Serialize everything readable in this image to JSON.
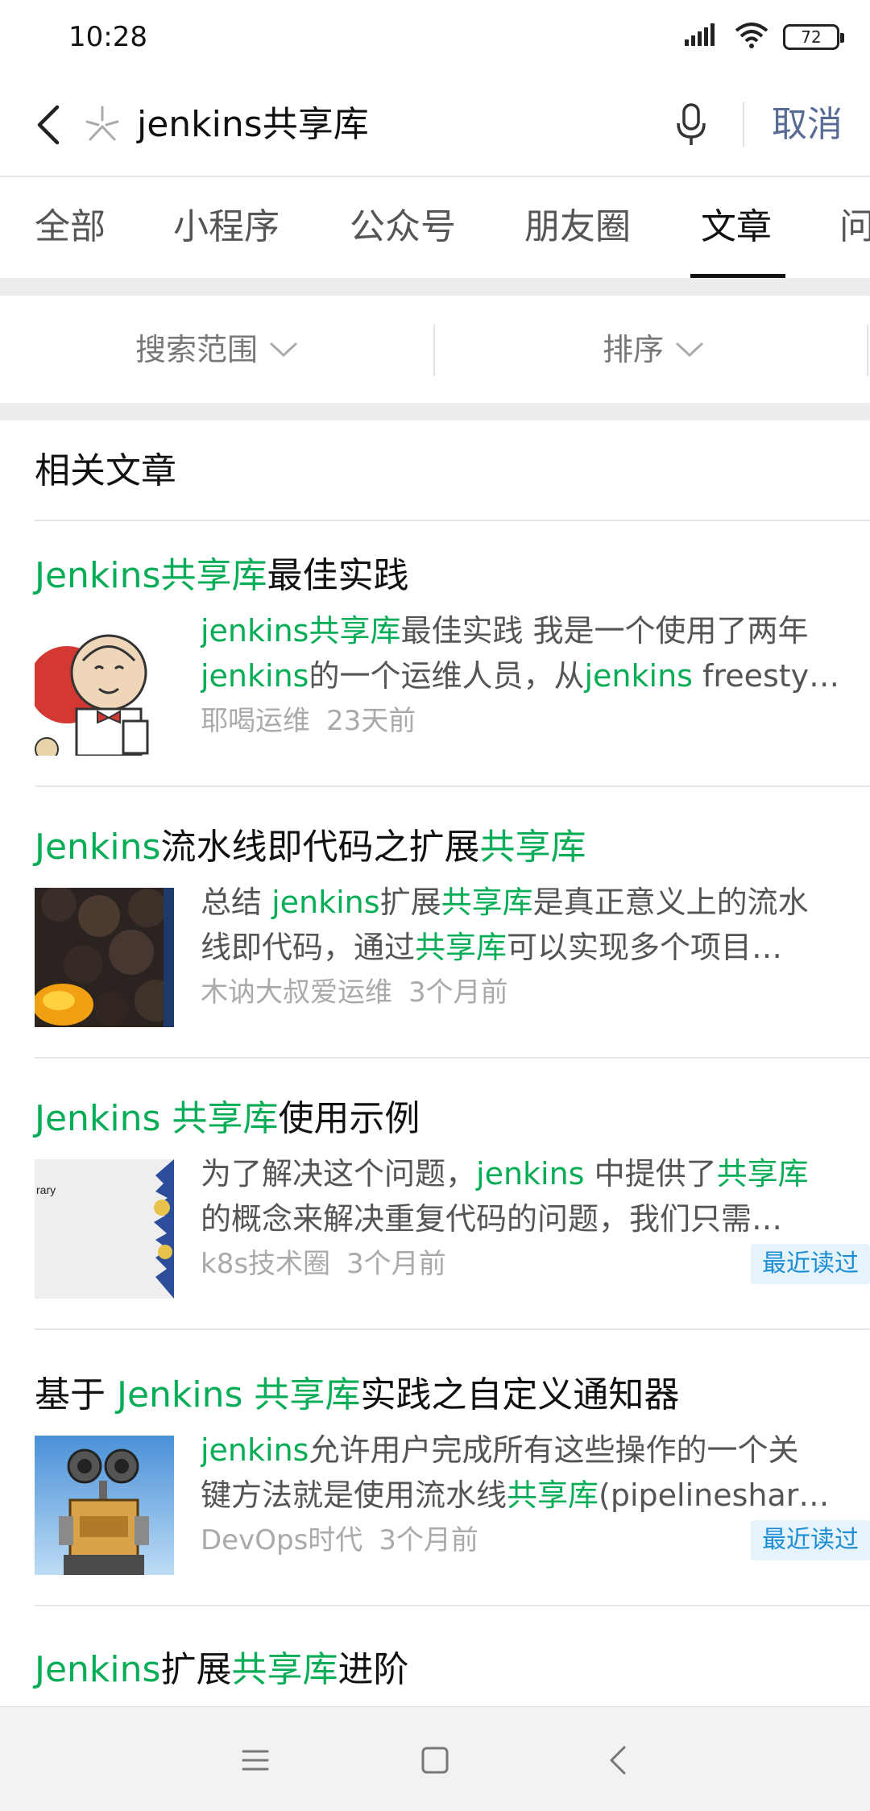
{
  "status_bar": {
    "time": "10:28",
    "battery": "72"
  },
  "search": {
    "query": "jenkins共享库",
    "cancel_label": "取消"
  },
  "tabs": [
    {
      "label": "全部"
    },
    {
      "label": "小程序"
    },
    {
      "label": "公众号"
    },
    {
      "label": "朋友圈"
    },
    {
      "label": "文章",
      "active": true
    },
    {
      "label": "问"
    }
  ],
  "filters": {
    "scope_label": "搜索范围",
    "sort_label": "排序"
  },
  "section": {
    "title": "相关文章"
  },
  "articles": [
    {
      "title_parts": [
        {
          "text": "Jenkins共享库",
          "highlight": true
        },
        {
          "text": "最佳实践",
          "highlight": false
        }
      ],
      "snippet_line1": [
        {
          "text": "jenkins共享库",
          "highlight": true
        },
        {
          "text": "最佳实践 我是一个使用了两年",
          "highlight": false
        }
      ],
      "snippet_line2": [
        {
          "text": "jenkins",
          "highlight": true
        },
        {
          "text": "的一个运维人员，从",
          "highlight": false
        },
        {
          "text": "jenkins",
          "highlight": true
        },
        {
          "text": " freesty…",
          "highlight": false
        }
      ],
      "source": "耶喝运维",
      "time": "23天前",
      "badge": ""
    },
    {
      "title_parts": [
        {
          "text": "Jenkins",
          "highlight": true
        },
        {
          "text": "流水线即代码之扩展",
          "highlight": false
        },
        {
          "text": "共享库",
          "highlight": true
        }
      ],
      "snippet_line1": [
        {
          "text": "总结 ",
          "highlight": false
        },
        {
          "text": "jenkins",
          "highlight": true
        },
        {
          "text": "扩展",
          "highlight": false
        },
        {
          "text": "共享库",
          "highlight": true
        },
        {
          "text": "是真正意义上的流水",
          "highlight": false
        }
      ],
      "snippet_line2": [
        {
          "text": "线即代码，通过",
          "highlight": false
        },
        {
          "text": "共享库",
          "highlight": true
        },
        {
          "text": "可以实现多个项目…",
          "highlight": false
        }
      ],
      "source": "木讷大叔爱运维",
      "time": "3个月前",
      "badge": ""
    },
    {
      "title_parts": [
        {
          "text": "Jenkins 共享库",
          "highlight": true
        },
        {
          "text": "使用示例",
          "highlight": false
        }
      ],
      "snippet_line1": [
        {
          "text": "为了解决这个问题，",
          "highlight": false
        },
        {
          "text": "jenkins",
          "highlight": true
        },
        {
          "text": " 中提供了",
          "highlight": false
        },
        {
          "text": "共享库",
          "highlight": true
        }
      ],
      "snippet_line2": [
        {
          "text": "的概念来解决重复代码的问题，我们只需…",
          "highlight": false
        }
      ],
      "source": "k8s技术圈",
      "time": "3个月前",
      "badge": "最近读过",
      "thumb_text": "rary"
    },
    {
      "title_parts": [
        {
          "text": "基于 ",
          "highlight": false
        },
        {
          "text": "Jenkins 共享库",
          "highlight": true
        },
        {
          "text": "实践之自定义通知器",
          "highlight": false
        }
      ],
      "snippet_line1": [
        {
          "text": "jenkins",
          "highlight": true
        },
        {
          "text": "允许用户完成所有这些操作的一个关",
          "highlight": false
        }
      ],
      "snippet_line2": [
        {
          "text": "键方法就是使用流水线",
          "highlight": false
        },
        {
          "text": "共享库",
          "highlight": true
        },
        {
          "text": "(pipelineshar…",
          "highlight": false
        }
      ],
      "source": "DevOps时代",
      "time": "3个月前",
      "badge": "最近读过"
    }
  ],
  "partial_article": {
    "title_parts": [
      {
        "text": "Jenkins",
        "highlight": true
      },
      {
        "text": "扩展",
        "highlight": false
      },
      {
        "text": "共享库",
        "highlight": true
      },
      {
        "text": "进阶",
        "highlight": false
      }
    ]
  },
  "colors": {
    "highlight": "#06ad56",
    "cancel": "#576b95",
    "badge_bg": "#e6f3fb",
    "badge_text": "#1b8ed6"
  },
  "icons": {
    "back": "chevron-left-icon",
    "logo": "wechat-search-icon",
    "mic": "microphone-icon",
    "dropdown": "chevron-down-icon",
    "signal": "signal-icon",
    "wifi": "wifi-icon",
    "battery": "battery-icon",
    "nav_menu": "menu-icon",
    "nav_home": "home-icon",
    "nav_back": "back-icon"
  }
}
